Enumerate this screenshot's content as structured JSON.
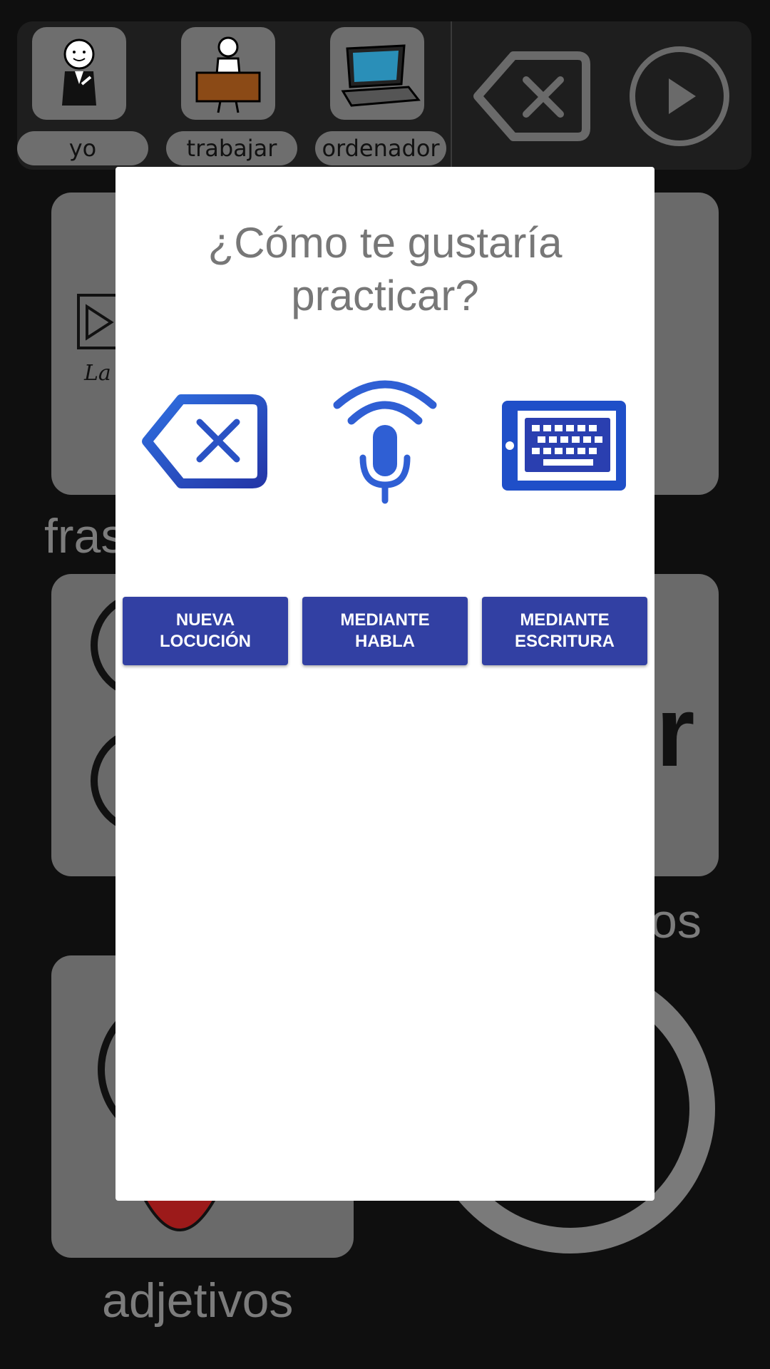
{
  "sentence_bar": {
    "words": [
      {
        "label": "yo",
        "icon": "person-pointing-self-icon"
      },
      {
        "label": "trabajar",
        "icon": "person-at-desk-icon"
      },
      {
        "label": "ordenador",
        "icon": "laptop-icon"
      }
    ],
    "delete_icon": "backspace-icon",
    "play_icon": "play-icon"
  },
  "background_categories": {
    "frases_label": "fras",
    "os_label": "os",
    "adjetivos_label": "adjetivos",
    "card_text_fragment": "La",
    "big_letter": "r"
  },
  "dialog": {
    "title": "¿Cómo te gustaría\npracticar?",
    "options": [
      {
        "icon": "backspace-icon",
        "label": "NUEVA\nLOCUCIÓN"
      },
      {
        "icon": "microphone-icon",
        "label": "MEDIANTE\nHABLA"
      },
      {
        "icon": "keyboard-tablet-icon",
        "label": "MEDIANTE\nESCRITURA"
      }
    ]
  },
  "colors": {
    "accent": "#3240a3",
    "icon_blue": "#2a52c4",
    "title_gray": "#777777"
  }
}
